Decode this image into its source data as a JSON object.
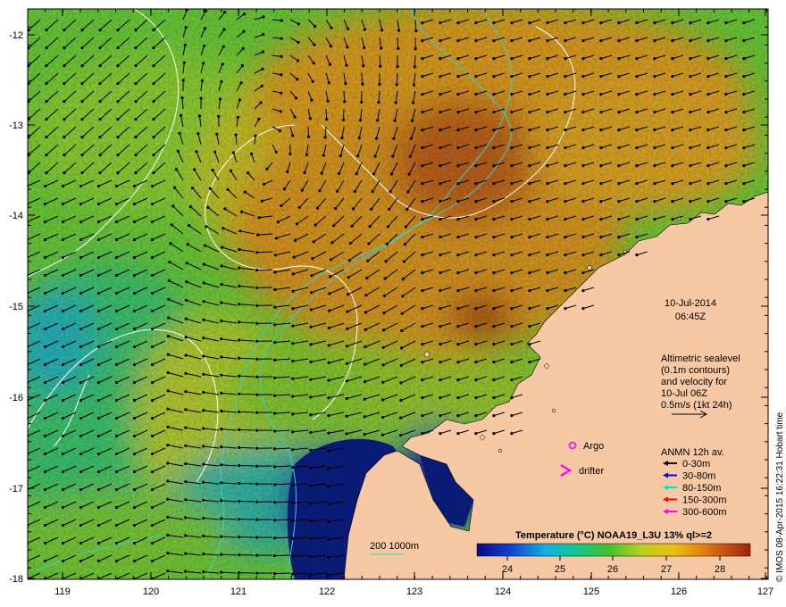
{
  "map": {
    "lon_ticks": [
      "119",
      "120",
      "121",
      "122",
      "123",
      "124",
      "125",
      "126",
      "127"
    ],
    "lat_ticks": [
      "-12",
      "-13",
      "-14",
      "-15",
      "-16",
      "-17",
      "-18"
    ],
    "date": "10-Jul-2014",
    "time": "06:45Z",
    "altimetry_lines": [
      "Altimetric sealevel",
      "(0.1m contours)",
      "and velocity for",
      "10-Jul 06Z",
      "0.5m/s (1kt 24h)"
    ],
    "argo_label": "Argo",
    "drifter_label": "drifter",
    "anmn_title": "ANMN 12h av.",
    "anmn_items": [
      {
        "label": "0-30m",
        "color": "#000000"
      },
      {
        "label": "30-80m",
        "color": "#0000ff"
      },
      {
        "label": "80-150m",
        "color": "#00e0e0"
      },
      {
        "label": "150-300m",
        "color": "#ff0000"
      },
      {
        "label": "300-600m",
        "color": "#ff00ff"
      }
    ],
    "isobath_label": "200  1000m",
    "credit": "© IMOS 08-Apr-2015 16:22:31 Hobart time",
    "colorbar_title": "Temperature (°C) NOAA19_L3U 13% ql>=2",
    "colorbar_ticks": [
      "24",
      "25",
      "26",
      "27",
      "28"
    ],
    "colors": {
      "land": "#f6c9a4",
      "warm": "#d98a1f",
      "hot": "#b5541a",
      "mid": "#c8c82e",
      "green": "#5fcf3c",
      "teal": "#30c0b8",
      "cold": "#0a1e8a",
      "isobath": "#3ecccc",
      "argo": "#ff00ff"
    }
  }
}
